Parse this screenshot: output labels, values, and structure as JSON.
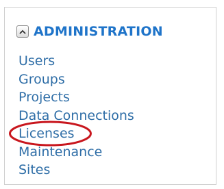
{
  "admin_section": {
    "title": "ADMINISTRATION",
    "toggle_icon": "chevron-up-icon",
    "items": [
      {
        "label": "Users"
      },
      {
        "label": "Groups"
      },
      {
        "label": "Projects"
      },
      {
        "label": "Data Connections"
      },
      {
        "label": "Licenses"
      },
      {
        "label": "Maintenance"
      },
      {
        "label": "Sites"
      }
    ],
    "highlighted_item": "Licenses",
    "highlight_color": "#c8161d"
  }
}
